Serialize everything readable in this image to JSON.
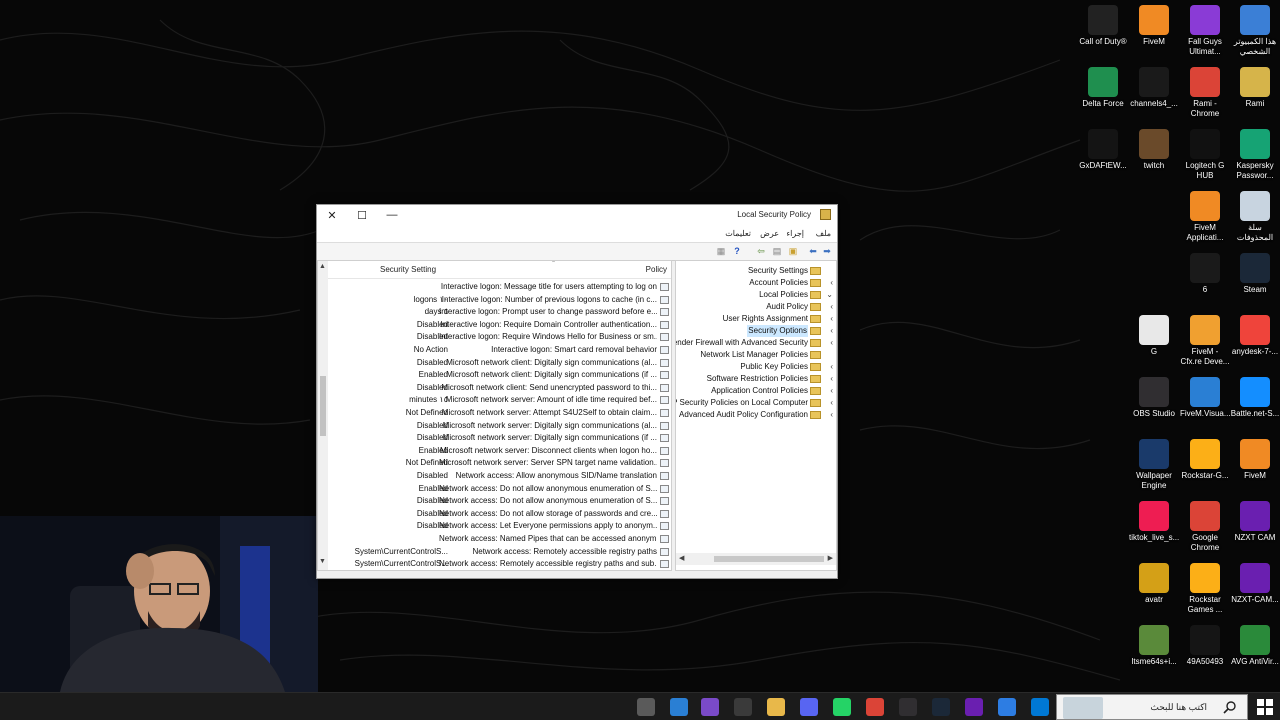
{
  "window": {
    "title": "Local Security Policy",
    "menus": [
      "ملف",
      "إجراء",
      "عرض",
      "تعليمات"
    ]
  },
  "columns": {
    "policy": "Policy",
    "setting": "Security Setting"
  },
  "rows": [
    {
      "policy": "Interactive logon: Message title for users attempting to log on",
      "setting": ""
    },
    {
      "policy": "Interactive logon: Number of previous logons to cache (in c...",
      "setting": "logons ١٠"
    },
    {
      "policy": "Interactive logon: Prompt user to change password before e...",
      "setting": "days ٥"
    },
    {
      "policy": "Interactive logon: Require Domain Controller authentication...",
      "setting": "Disabled"
    },
    {
      "policy": "Interactive logon: Require Windows Hello for Business or sm...",
      "setting": "Disabled"
    },
    {
      "policy": "Interactive logon: Smart card removal behavior",
      "setting": "No Action"
    },
    {
      "policy": "Microsoft network client: Digitally sign communications (al...",
      "setting": "Disabled"
    },
    {
      "policy": "Microsoft network client: Digitally sign communications (if ...",
      "setting": "Enabled"
    },
    {
      "policy": "Microsoft network client: Send unencrypted password to thi...",
      "setting": "Disabled"
    },
    {
      "policy": "Microsoft network server: Amount of idle time required bef...",
      "setting": "minutes ١٥"
    },
    {
      "policy": "Microsoft network server: Attempt S4U2Self to obtain claim...",
      "setting": "Not Defined"
    },
    {
      "policy": "Microsoft network server: Digitally sign communications (al...",
      "setting": "Disabled"
    },
    {
      "policy": "Microsoft network server: Digitally sign communications (if ...",
      "setting": "Disabled"
    },
    {
      "policy": "Microsoft network server: Disconnect clients when logon ho...",
      "setting": "Enabled"
    },
    {
      "policy": "Microsoft network server: Server SPN target name validation...",
      "setting": "Not Defined"
    },
    {
      "policy": "Network access: Allow anonymous SID/Name translation",
      "setting": "Disabled"
    },
    {
      "policy": "Network access: Do not allow anonymous enumeration of S...",
      "setting": "Enabled"
    },
    {
      "policy": "Network access: Do not allow anonymous enumeration of S...",
      "setting": "Disabled"
    },
    {
      "policy": "Network access: Do not allow storage of passwords and cre...",
      "setting": "Disabled"
    },
    {
      "policy": "Network access: Let Everyone permissions apply to anonym...",
      "setting": "Disabled"
    },
    {
      "policy": "Network access: Named Pipes that can be accessed anonym...",
      "setting": ""
    },
    {
      "policy": "Network access: Remotely accessible registry paths",
      "setting": "System\\CurrentControlS..."
    },
    {
      "policy": "Network access: Remotely accessible registry paths and sub...",
      "setting": "System\\CurrentControlS..."
    }
  ],
  "tree": [
    {
      "label": "Security Settings",
      "chev": ""
    },
    {
      "label": "Account Policies",
      "chev": "‹"
    },
    {
      "label": "Local Policies",
      "chev": "⌄"
    },
    {
      "label": "Audit Policy",
      "chev": "‹"
    },
    {
      "label": "User Rights Assignment",
      "chev": "‹"
    },
    {
      "label": "Security Options",
      "chev": "‹"
    },
    {
      "label": "Windows Defender Firewall with Advanced Security",
      "chev": "‹"
    },
    {
      "label": "Network List Manager Policies",
      "chev": ""
    },
    {
      "label": "Public Key Policies",
      "chev": "‹"
    },
    {
      "label": "Software Restriction Policies",
      "chev": "‹"
    },
    {
      "label": "Application Control Policies",
      "chev": "‹"
    },
    {
      "label": "IP Security Policies on Local Computer",
      "chev": "‹"
    },
    {
      "label": "Advanced Audit Policy Configuration",
      "chev": "‹"
    }
  ],
  "desktop_icons": [
    {
      "label": "هذا الكمبيوتر الشخصي",
      "color": "#3b7fd6"
    },
    {
      "label": "Fall Guys Ultimat...",
      "color": "#8a3bd6"
    },
    {
      "label": "FiveM",
      "color": "#f08a24"
    },
    {
      "label": "Call of Duty®",
      "color": "#222222"
    },
    {
      "label": "Rami",
      "color": "#d6b44a"
    },
    {
      "label": "Rami - Chrome",
      "color": "#db4437"
    },
    {
      "label": "channels4_...",
      "color": "#1a1a1a"
    },
    {
      "label": "Delta Force",
      "color": "#1f8f4f"
    },
    {
      "label": "Kaspersky Passwor...",
      "color": "#16a374"
    },
    {
      "label": "Logitech G HUB",
      "color": "#111111"
    },
    {
      "label": "twitch",
      "color": "#6a4a2a"
    },
    {
      "label": "GxDAFtEW...",
      "color": "#141414"
    },
    {
      "label": "سلة المحذوفات",
      "color": "#c8d4e0"
    },
    {
      "label": "FiveM Applicati...",
      "color": "#f08a24"
    },
    {
      "label": "Steam",
      "color": "#1b2838"
    },
    {
      "label": "6",
      "color": "#1a1a1a"
    },
    {
      "label": "anydesk-7-...",
      "color": "#ef443b"
    },
    {
      "label": "FiveM - Cfx.re Deve...",
      "color": "#f0a030"
    },
    {
      "label": "G",
      "color": "#e8e8e8"
    },
    {
      "label": "Battle.net-S...",
      "color": "#148eff"
    },
    {
      "label": "FiveM.Visua...",
      "color": "#2a7fd4"
    },
    {
      "label": "OBS Studio",
      "color": "#302e31"
    },
    {
      "label": "FiveM",
      "color": "#f08a24"
    },
    {
      "label": "Rockstar-G...",
      "color": "#fcaf17"
    },
    {
      "label": "Wallpaper Engine",
      "color": "#1a3a6a"
    },
    {
      "label": "NZXT CAM",
      "color": "#6a1fb0"
    },
    {
      "label": "Google Chrome",
      "color": "#db4437"
    },
    {
      "label": "tiktok_live_s...",
      "color": "#ee1d52"
    },
    {
      "label": "NZXT-CAM...",
      "color": "#6a1fb0"
    },
    {
      "label": "Rockstar Games ...",
      "color": "#fcaf17"
    },
    {
      "label": "avatr",
      "color": "#d4a017"
    },
    {
      "label": "AVG AntiVir...",
      "color": "#2a8a3a"
    },
    {
      "label": "49A50493",
      "color": "#151515"
    },
    {
      "label": "Itsme64s+i...",
      "color": "#5a8a3a"
    }
  ],
  "taskbar": {
    "search_placeholder": "اكتب هنا للبحث",
    "icons": [
      "task-view",
      "security-policy",
      "fivem",
      "nzxt",
      "steam",
      "obs",
      "chrome",
      "whatsapp",
      "discord",
      "file-explorer",
      "store",
      "copilot",
      "edge"
    ]
  },
  "colors": {
    "accent": "#0078d4",
    "taskbar": "#1b1b1b",
    "selection": "#cce8ff"
  }
}
